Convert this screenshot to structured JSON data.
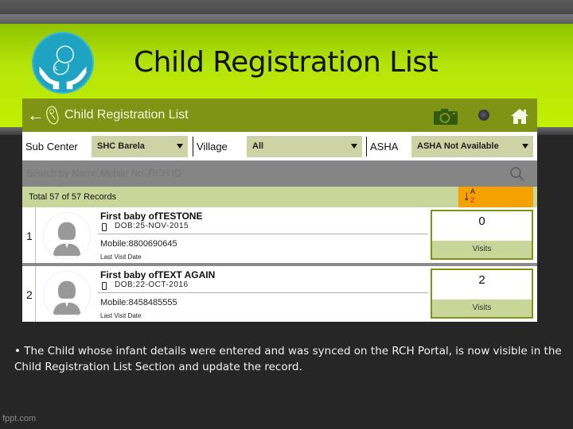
{
  "slide": {
    "title": "Child Registration List",
    "caption": "• The Child whose infant details were entered and was synced on the RCH Portal, is now visible in the Child Registration List Section and update the record.",
    "footer_brand": "fppt.com",
    "logo_icon": "baby-in-hands-icon"
  },
  "app": {
    "title": "Child Registration List",
    "colors": {
      "appbar": "#7f9415",
      "accent": "#f5a200",
      "light_green": "#c9d69a"
    },
    "toolbar_icons": [
      "back-arrow-icon",
      "mother-child-logo-icon",
      "camera-icon",
      "record-dot-icon",
      "home-icon"
    ],
    "filters": {
      "sub_center_label": "Sub Center",
      "sub_center_value": "SHC Barela",
      "village_label": "Village",
      "village_value": "All",
      "asha_label": "ASHA",
      "asha_value": "ASHA Not Available"
    },
    "search": {
      "placeholder": "Search by Name,Mobile No.,RCH ID",
      "value": ""
    },
    "count_text": "Total 57 of 57 Records",
    "sort": {
      "top": "A",
      "bottom": "Z",
      "arrow": "↓"
    },
    "records": [
      {
        "index": "1",
        "name": "First baby ofTESTONE",
        "dob": "DOB:25-NOV-2015",
        "mobile": "Mobile:8800690645",
        "last_visit_label": "Last Visit Date",
        "visits": "0",
        "visits_label": "Visits"
      },
      {
        "index": "2",
        "name": "First baby ofTEXT AGAIN",
        "dob": "DOB:22-OCT-2016",
        "mobile": "Mobile:8458485555",
        "last_visit_label": "Last Visit Date",
        "visits": "2",
        "visits_label": "Visits"
      }
    ]
  }
}
